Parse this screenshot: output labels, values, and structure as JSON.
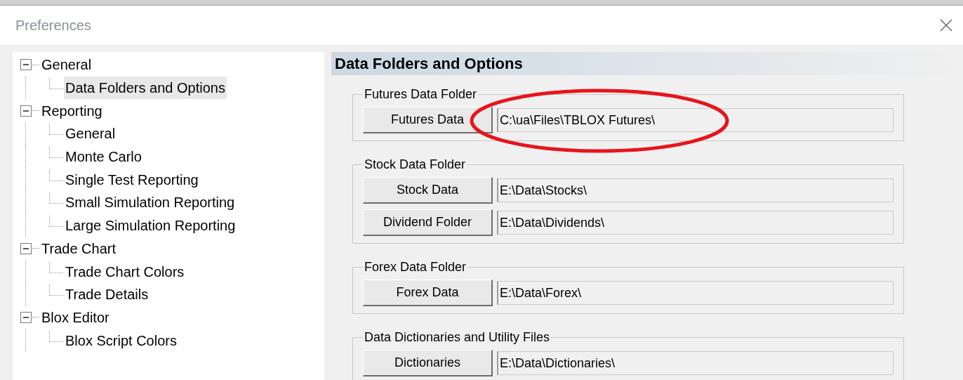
{
  "window": {
    "title": "Preferences"
  },
  "tree": [
    {
      "label": "General",
      "expanded": true,
      "selected": false,
      "children": [
        {
          "label": "Data Folders and Options",
          "selected": true
        }
      ]
    },
    {
      "label": "Reporting",
      "expanded": true,
      "selected": false,
      "children": [
        {
          "label": "General",
          "selected": false
        },
        {
          "label": "Monte Carlo",
          "selected": false
        },
        {
          "label": "Single Test Reporting",
          "selected": false
        },
        {
          "label": "Small Simulation Reporting",
          "selected": false
        },
        {
          "label": "Large Simulation Reporting",
          "selected": false
        }
      ]
    },
    {
      "label": "Trade Chart",
      "expanded": true,
      "selected": false,
      "children": [
        {
          "label": "Trade Chart Colors",
          "selected": false
        },
        {
          "label": "Trade Details",
          "selected": false
        }
      ]
    },
    {
      "label": "Blox Editor",
      "expanded": true,
      "selected": false,
      "children": [
        {
          "label": "Blox Script Colors",
          "selected": false
        }
      ]
    }
  ],
  "panel": {
    "title": "Data Folders and Options",
    "groups": [
      {
        "title": "Futures Data Folder",
        "rows": [
          {
            "button": "Futures Data",
            "path": "C:\\ua\\Files\\TBLOX Futures\\"
          }
        ]
      },
      {
        "title": "Stock Data Folder",
        "rows": [
          {
            "button": "Stock Data",
            "path": "E:\\Data\\Stocks\\"
          },
          {
            "button": "Dividend Folder",
            "path": "E:\\Data\\Dividends\\"
          }
        ]
      },
      {
        "title": "Forex Data Folder",
        "rows": [
          {
            "button": "Forex Data",
            "path": "E:\\Data\\Forex\\"
          }
        ]
      },
      {
        "title": "Data Dictionaries and Utility Files",
        "rows": [
          {
            "button": "Dictionaries",
            "path": "E:\\Data\\Dictionaries\\"
          }
        ]
      }
    ]
  }
}
